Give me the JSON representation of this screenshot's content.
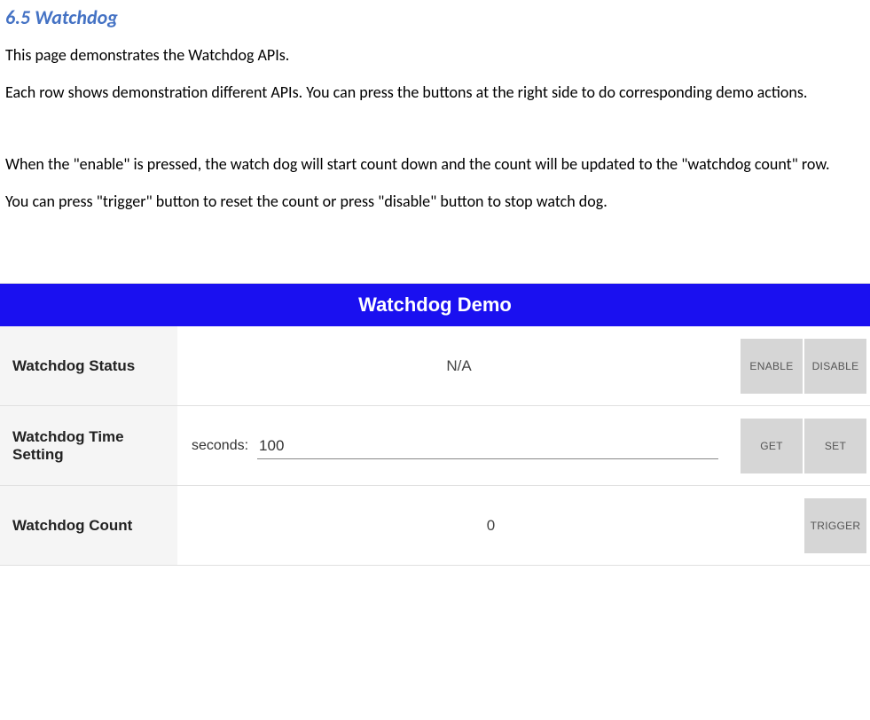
{
  "heading": "6.5 Watchdog",
  "paragraphs": {
    "p1": "This page demonstrates the Watchdog APIs.",
    "p2": "Each row shows demonstration different APIs. You can press the buttons at the right side to do corresponding demo actions.",
    "p3": "When the \"enable\" is pressed, the watch dog will start count down and the count will be updated to the \"watchdog count\" row.",
    "p4": "You can press \"trigger\" button to reset the count or press \"disable\" button to stop watch dog."
  },
  "demo": {
    "title": "Watchdog Demo",
    "rows": {
      "status": {
        "label": "Watchdog Status",
        "value": "N/A",
        "buttons": {
          "enable": "ENABLE",
          "disable": "DISABLE"
        }
      },
      "time": {
        "label": "Watchdog Time Setting",
        "seconds_label": "seconds:",
        "value": "100",
        "buttons": {
          "get": "GET",
          "set": "SET"
        }
      },
      "count": {
        "label": "Watchdog Count",
        "value": "0",
        "buttons": {
          "trigger": "TRIGGER"
        }
      }
    }
  }
}
